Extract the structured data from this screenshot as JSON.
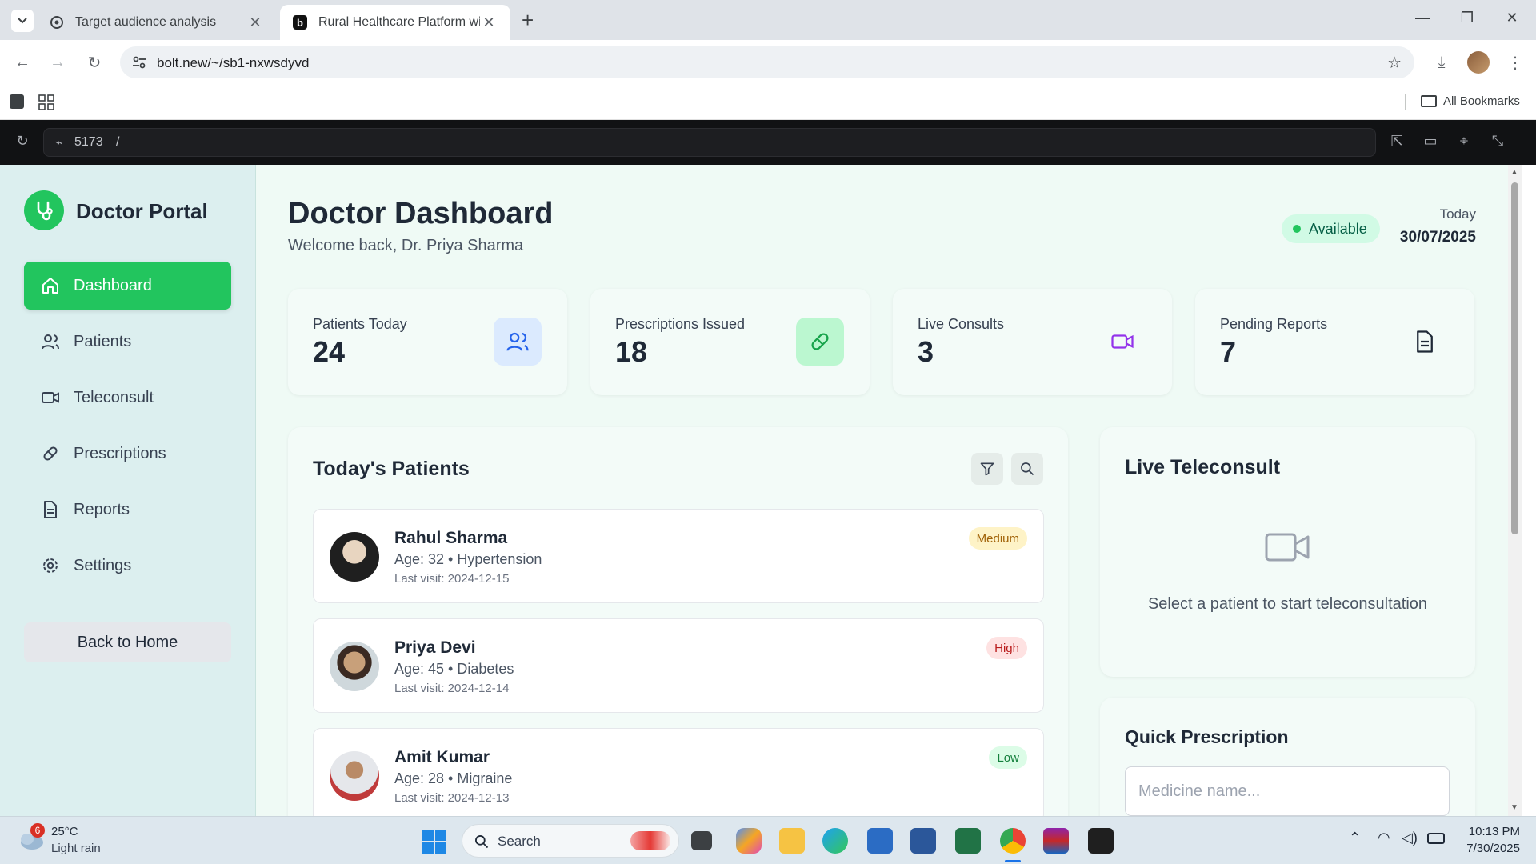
{
  "browser": {
    "tabs": [
      {
        "title": "Target audience analysis",
        "active": false
      },
      {
        "title": "Rural Healthcare Platform with I",
        "active": true
      }
    ],
    "url": "bolt.new/~/sb1-nxwsdyvd",
    "bookmarks_label": "All Bookmarks"
  },
  "preview": {
    "port": "5173",
    "path": "/"
  },
  "sidebar": {
    "brand": "Doctor Portal",
    "items": [
      {
        "label": "Dashboard",
        "icon": "home-icon",
        "active": true
      },
      {
        "label": "Patients",
        "icon": "users-icon",
        "active": false
      },
      {
        "label": "Teleconsult",
        "icon": "video-icon",
        "active": false
      },
      {
        "label": "Prescriptions",
        "icon": "pill-icon",
        "active": false
      },
      {
        "label": "Reports",
        "icon": "file-icon",
        "active": false
      },
      {
        "label": "Settings",
        "icon": "gear-icon",
        "active": false
      }
    ],
    "back_home": "Back to Home"
  },
  "header": {
    "title": "Doctor Dashboard",
    "welcome": "Welcome back, Dr. Priya Sharma",
    "status": "Available",
    "today_label": "Today",
    "date": "30/07/2025"
  },
  "stats": [
    {
      "label": "Patients Today",
      "value": "24",
      "icon": "users-icon",
      "color": "#2563eb"
    },
    {
      "label": "Prescriptions Issued",
      "value": "18",
      "icon": "pill-icon",
      "color": "#16a34a"
    },
    {
      "label": "Live Consults",
      "value": "3",
      "icon": "video-icon",
      "color": "#9333ea"
    },
    {
      "label": "Pending Reports",
      "value": "7",
      "icon": "file-icon",
      "color": "#1f2937"
    }
  ],
  "patients": {
    "title": "Today's Patients",
    "list": [
      {
        "name": "Rahul Sharma",
        "meta": "Age: 32 • Hypertension",
        "last": "Last visit: 2024-12-15",
        "priority": "Medium",
        "color": "#a16207",
        "bg": "#fef3c7"
      },
      {
        "name": "Priya Devi",
        "meta": "Age: 45 • Diabetes",
        "last": "Last visit: 2024-12-14",
        "priority": "High",
        "color": "#b91c1c",
        "bg": "#fee2e2"
      },
      {
        "name": "Amit Kumar",
        "meta": "Age: 28 • Migraine",
        "last": "Last visit: 2024-12-13",
        "priority": "Low",
        "color": "#15803d",
        "bg": "#dcfce7"
      }
    ]
  },
  "teleconsult": {
    "title": "Live Teleconsult",
    "empty": "Select a patient to start teleconsultation"
  },
  "quick_prescription": {
    "title": "Quick Prescription",
    "placeholder": "Medicine name..."
  },
  "taskbar": {
    "weather_temp": "25°C",
    "weather_desc": "Light rain",
    "weather_badge": "6",
    "search": "Search",
    "time": "10:13 PM",
    "date": "7/30/2025"
  }
}
